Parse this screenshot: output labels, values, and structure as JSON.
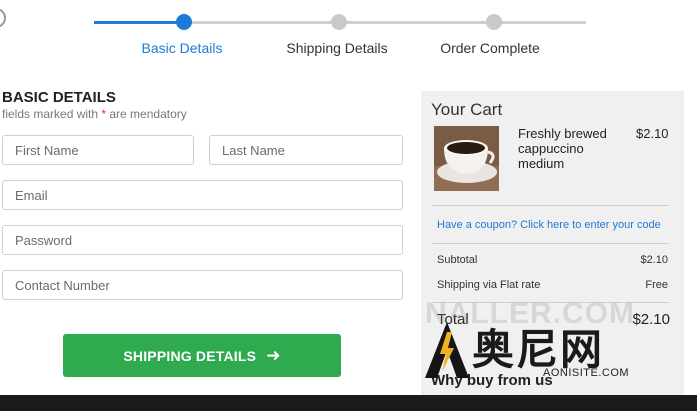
{
  "stepper": {
    "steps": [
      {
        "label": "Basic Details",
        "state": "active"
      },
      {
        "label": "Shipping Details",
        "state": "inactive"
      },
      {
        "label": "Order Complete",
        "state": "inactive"
      }
    ],
    "active_color": "#1e7ad7",
    "inactive_color": "#c9c9c9"
  },
  "form": {
    "heading": "BASIC DETAILS",
    "subtext_before": "fields marked with ",
    "required_mark": "*",
    "subtext_after": " are mendatory",
    "fields": {
      "first_name": {
        "placeholder": "First Name",
        "value": ""
      },
      "last_name": {
        "placeholder": "Last Name",
        "value": ""
      },
      "email": {
        "placeholder": "Email",
        "value": ""
      },
      "password": {
        "placeholder": "Password",
        "value": ""
      },
      "contact": {
        "placeholder": "Contact Number",
        "value": ""
      }
    },
    "submit_label": "SHIPPING DETAILS",
    "submit_icon": "arrow-right-icon",
    "submit_color": "#2faa4f"
  },
  "cart": {
    "title": "Your Cart",
    "item": {
      "name": "Freshly brewed cappuccino medium",
      "price": "$2.10",
      "image": "coffee-cup-image"
    },
    "coupon_text": "Have a coupon? Click here to enter your code",
    "subtotal_label": "Subtotal",
    "subtotal_value": "$2.10",
    "shipping_label": "Shipping via Flat rate",
    "shipping_value": "Free",
    "total_label": "Total",
    "total_value": "$2.10",
    "why_buy": "Why buy from us"
  },
  "watermark": {
    "ghost_text": "NALLER.COM",
    "brand_text": "奥尼网",
    "sub_text": "AONISITE.COM"
  }
}
